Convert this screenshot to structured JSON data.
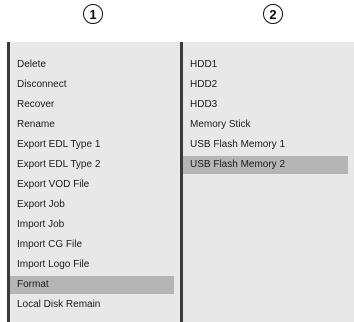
{
  "steps": {
    "first": "1",
    "second": "2"
  },
  "left_menu": {
    "items": [
      {
        "label": "Delete"
      },
      {
        "label": "Disconnect"
      },
      {
        "label": "Recover"
      },
      {
        "label": "Rename"
      },
      {
        "label": "Export EDL Type 1"
      },
      {
        "label": "Export EDL Type 2"
      },
      {
        "label": "Export VOD File"
      },
      {
        "label": "Export Job"
      },
      {
        "label": "Import Job"
      },
      {
        "label": "Import CG File"
      },
      {
        "label": "Import Logo File"
      },
      {
        "label": "Format"
      },
      {
        "label": "Local Disk Remain"
      }
    ],
    "selected": "Format"
  },
  "right_menu": {
    "items": [
      {
        "label": "HDD1"
      },
      {
        "label": "HDD2"
      },
      {
        "label": "HDD3"
      },
      {
        "label": "Memory Stick"
      },
      {
        "label": "USB Flash Memory 1"
      },
      {
        "label": "USB Flash Memory 2"
      }
    ],
    "selected": "USB Flash Memory 2"
  },
  "colors": {
    "panel_bg": "#e8e8e8",
    "selected_bg": "#b5b5b5",
    "panel_border": "#3a3a3a"
  }
}
